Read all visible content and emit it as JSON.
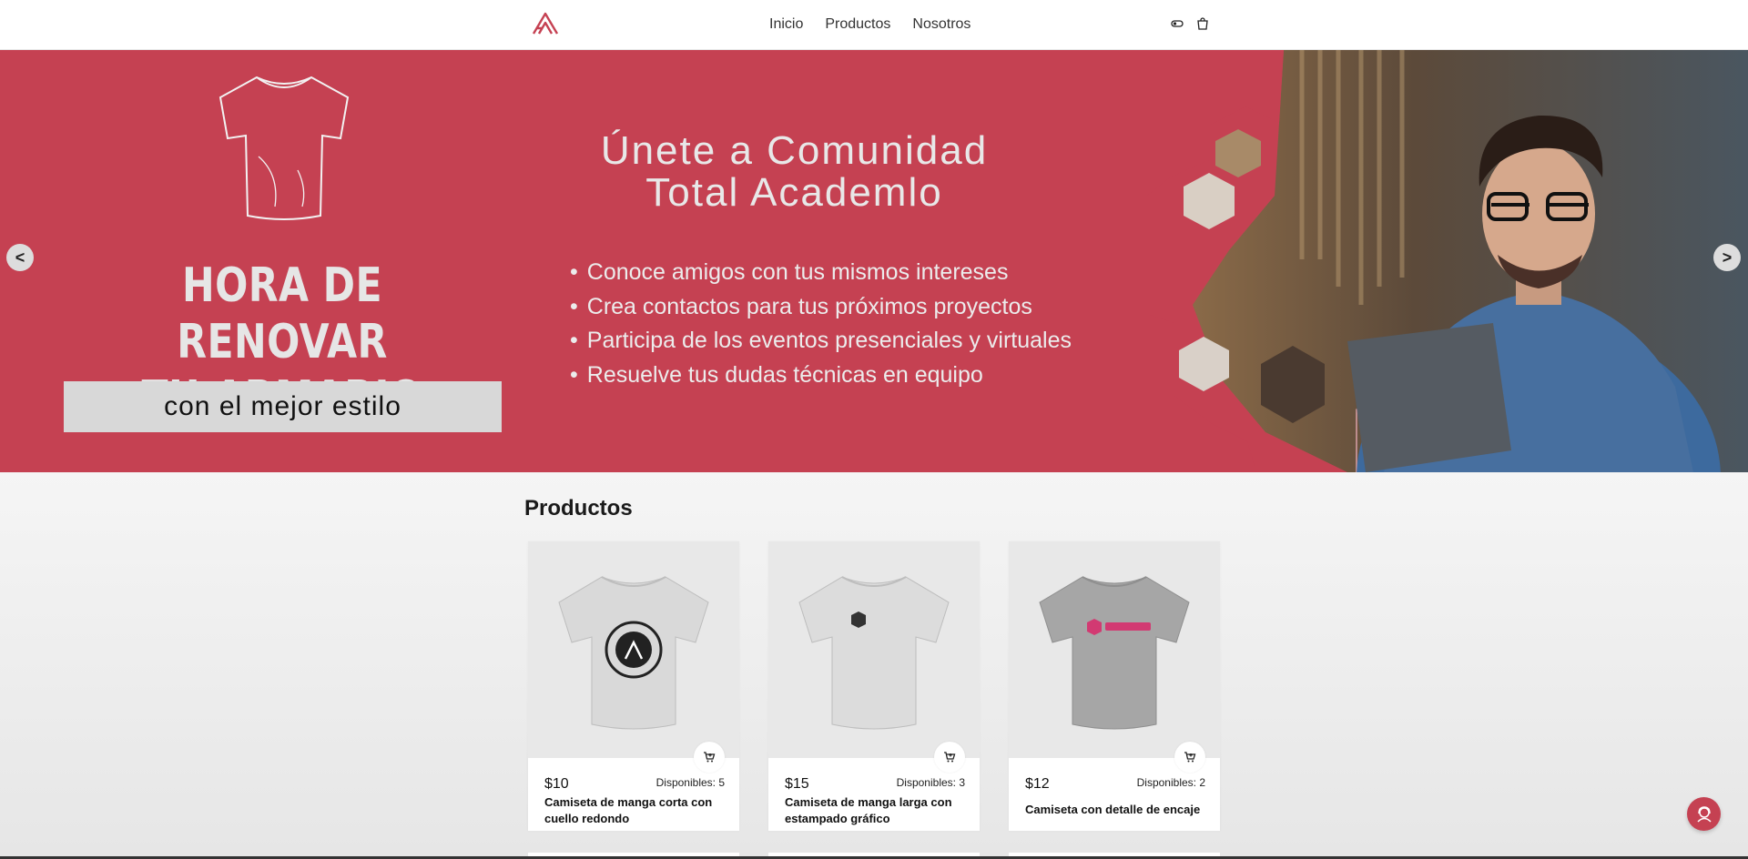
{
  "nav": {
    "logo": "academlo-logo-icon",
    "links": [
      "Inicio",
      "Productos",
      "Nosotros"
    ],
    "icons": [
      "logout-icon",
      "cart-icon"
    ]
  },
  "hero": {
    "left_title": "HORA DE RENOVAR\nTU ARMARIO",
    "left_subtitle": "con el mejor estilo",
    "center_title": "Únete a Comunidad\nTotal Academlo",
    "bullets": [
      "Conoce amigos con tus mismos intereses",
      "Crea contactos para tus próximos proyectos",
      "Participa de los eventos presenciales y virtuales",
      "Resuelve tus dudas técnicas en equipo"
    ],
    "prev_label": "<",
    "next_label": ">"
  },
  "products": {
    "title": "Productos",
    "items": [
      {
        "price": "$10",
        "stock": "Disponibles: 5",
        "name": "Camiseta de manga corta con cuello redondo",
        "shirt_color": "#d9d9d9",
        "print": "round-badge"
      },
      {
        "price": "$15",
        "stock": "Disponibles: 3",
        "name": "Camiseta de manga larga con estampado gráfico",
        "shirt_color": "#dcdcdc",
        "print": "small-logo"
      },
      {
        "price": "$12",
        "stock": "Disponibles: 2",
        "name": "Camiseta con detalle de encaje",
        "shirt_color": "#a6a6a6",
        "print": "academlo-wordmark"
      }
    ]
  },
  "colors": {
    "brand": "#c54152",
    "hero_bg": "#c54152"
  }
}
